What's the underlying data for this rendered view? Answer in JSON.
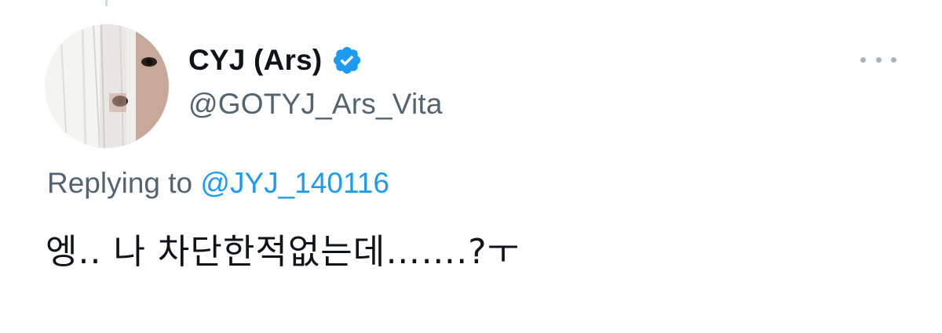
{
  "tweet": {
    "author": {
      "display_name": "CYJ (Ars)",
      "handle": "@GOTYJ_Ars_Vita",
      "verified": true,
      "verified_color": "#1d9bf0"
    },
    "reply": {
      "prefix": "Replying to",
      "mention": "@JYJ_140116"
    },
    "text": "엥.. 나 차단한적없는데…….?ㅜ",
    "more_icon": "more-horizontal-icon"
  },
  "colors": {
    "text_primary": "#0f1419",
    "text_secondary": "#536471",
    "link": "#1d9bf0"
  }
}
